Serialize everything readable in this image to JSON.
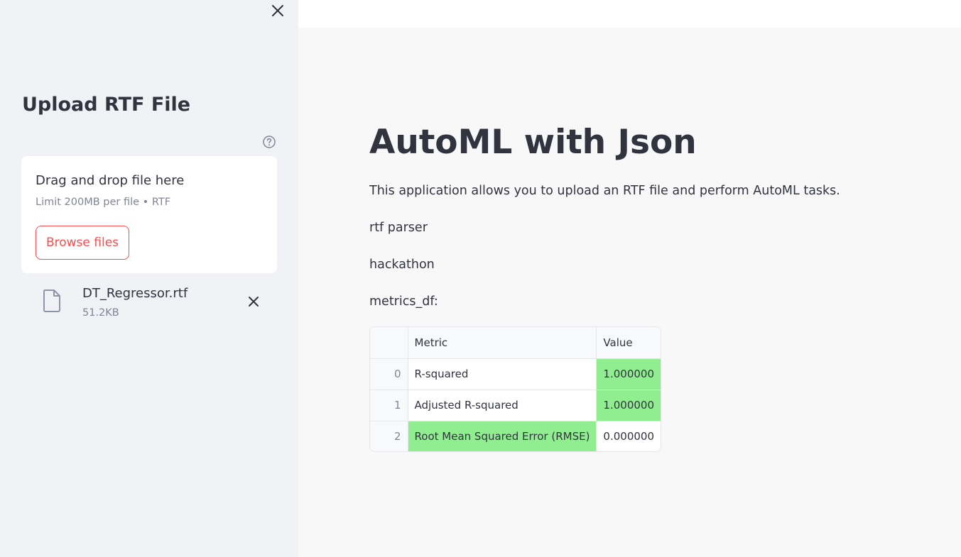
{
  "sidebar": {
    "title": "Upload RTF File",
    "close_icon": "close-icon",
    "help_icon": "help-circle-icon",
    "uploader": {
      "drop_text": "Drag and drop file here",
      "limit_text": "Limit 200MB per file • RTF",
      "browse_label": "Browse files"
    },
    "file": {
      "icon": "file-icon",
      "name": "DT_Regressor.rtf",
      "size": "51.2KB",
      "remove_icon": "close-icon"
    }
  },
  "main": {
    "title": "AutoML with Json",
    "description": "This application allows you to upload an RTF file and perform AutoML tasks.",
    "line1": "rtf parser",
    "line2": "hackathon",
    "df_label": "metrics_df:",
    "table": {
      "headers": [
        "",
        "Metric",
        "Value"
      ],
      "rows": [
        {
          "index": "0",
          "metric": "R-squared",
          "value": "1.000000"
        },
        {
          "index": "1",
          "metric": "Adjusted R-squared",
          "value": "1.000000"
        },
        {
          "index": "2",
          "metric": "Root Mean Squared Error (RMSE)",
          "value": "0.000000"
        }
      ]
    }
  },
  "colors": {
    "accent": "#ff4b4b",
    "highlight": "#90ee90",
    "sidebar_bg": "#f0f2f6",
    "main_bg": "#f8f8f8",
    "text": "#31333f",
    "muted": "#808495"
  }
}
